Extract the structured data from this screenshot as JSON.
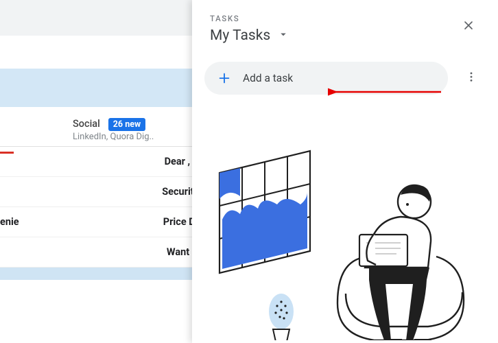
{
  "gmail": {
    "tab": {
      "label": "Social",
      "badge": "26 new",
      "senders": "LinkedIn, Quora Dig.."
    },
    "rows": [
      {
        "subject": "Dear , R"
      },
      {
        "subject": "Security"
      },
      {
        "from": "enie",
        "subject": "Price Dr"
      },
      {
        "subject": "Want N"
      }
    ]
  },
  "tasks": {
    "kicker": "TASKS",
    "list_name": "My Tasks",
    "add_label": "Add a task"
  }
}
